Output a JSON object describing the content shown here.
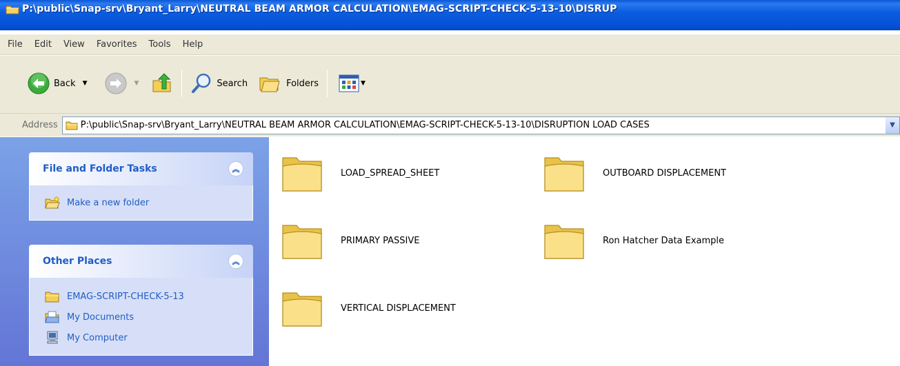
{
  "window": {
    "title": "P:\\public\\Snap-srv\\Bryant_Larry\\NEUTRAL BEAM ARMOR CALCULATION\\EMAG-SCRIPT-CHECK-5-13-10\\DISRUP"
  },
  "menubar": {
    "items": [
      "File",
      "Edit",
      "View",
      "Favorites",
      "Tools",
      "Help"
    ]
  },
  "toolbar": {
    "back_label": "Back",
    "search_label": "Search",
    "folders_label": "Folders"
  },
  "address": {
    "label": "Address",
    "value": "P:\\public\\Snap-srv\\Bryant_Larry\\NEUTRAL BEAM ARMOR CALCULATION\\EMAG-SCRIPT-CHECK-5-13-10\\DISRUPTION  LOAD CASES"
  },
  "tasks": {
    "file_folder": {
      "title": "File and Folder Tasks",
      "items": [
        "Make a new folder"
      ]
    },
    "other_places": {
      "title": "Other Places",
      "items": [
        "EMAG-SCRIPT-CHECK-5-13",
        "My Documents",
        "My Computer"
      ]
    }
  },
  "folders": [
    "LOAD_SPREAD_SHEET",
    "OUTBOARD DISPLACEMENT",
    "PRIMARY PASSIVE",
    "Ron Hatcher Data Example",
    "VERTICAL DISPLACEMENT"
  ],
  "colors": {
    "titlebar": "#0a58d4",
    "chrome": "#ece9d8",
    "taskpane": "#7ba2e7",
    "link": "#215dc6"
  }
}
